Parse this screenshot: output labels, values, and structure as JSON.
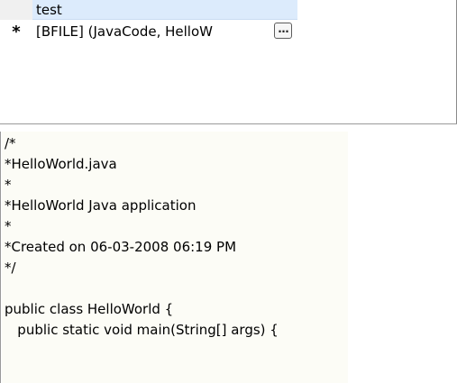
{
  "grid": {
    "column_header": "test",
    "row_marker": "*",
    "cell_value": "[BFILE] (JavaCode, HelloW",
    "ellipsis_label": "…"
  },
  "code": {
    "lines": [
      "/*",
      "*HelloWorld.java",
      "*",
      "*HelloWorld Java application",
      "*",
      "*Created on 06-03-2008 06:19 PM",
      "*/",
      "",
      "public class HelloWorld {",
      "   public static void main(String[] args) {"
    ]
  }
}
